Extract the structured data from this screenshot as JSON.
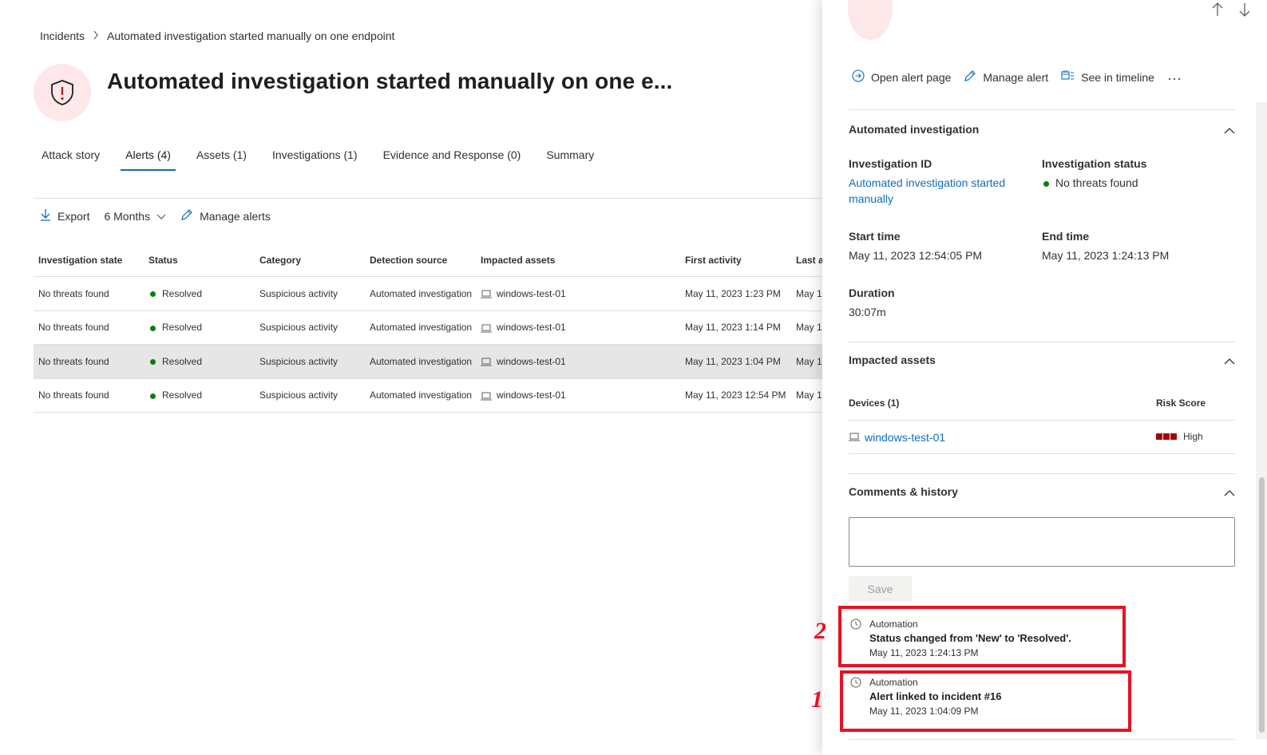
{
  "breadcrumb": {
    "root": "Incidents",
    "current": "Automated investigation started manually on one endpoint"
  },
  "page": {
    "title": "Automated investigation started manually on one e..."
  },
  "tabs": [
    {
      "label": "Attack story",
      "active": false
    },
    {
      "label": "Alerts (4)",
      "active": true
    },
    {
      "label": "Assets (1)",
      "active": false
    },
    {
      "label": "Investigations (1)",
      "active": false
    },
    {
      "label": "Evidence and Response (0)",
      "active": false
    },
    {
      "label": "Summary",
      "active": false
    }
  ],
  "toolbar": {
    "export": "Export",
    "range": "6 Months",
    "manage": "Manage alerts"
  },
  "table": {
    "headers": [
      "Investigation state",
      "Status",
      "Category",
      "Detection source",
      "Impacted assets",
      "First activity",
      "Last a"
    ],
    "rows": [
      {
        "state": "No threats found",
        "status": "Resolved",
        "category": "Suspicious activity",
        "source": "Automated investigation",
        "asset": "windows-test-01",
        "first": "May 11, 2023 1:23 PM",
        "last": "May 1",
        "selected": false
      },
      {
        "state": "No threats found",
        "status": "Resolved",
        "category": "Suspicious activity",
        "source": "Automated investigation",
        "asset": "windows-test-01",
        "first": "May 11, 2023 1:14 PM",
        "last": "May 1",
        "selected": false
      },
      {
        "state": "No threats found",
        "status": "Resolved",
        "category": "Suspicious activity",
        "source": "Automated investigation",
        "asset": "windows-test-01",
        "first": "May 11, 2023 1:04 PM",
        "last": "May 1",
        "selected": true
      },
      {
        "state": "No threats found",
        "status": "Resolved",
        "category": "Suspicious activity",
        "source": "Automated investigation",
        "asset": "windows-test-01",
        "first": "May 11, 2023 12:54 PM",
        "last": "May 1",
        "selected": false
      }
    ]
  },
  "panel": {
    "actions": {
      "open": "Open alert page",
      "manage": "Manage alert",
      "timeline": "See in timeline"
    },
    "auto": {
      "title": "Automated investigation",
      "id_label": "Investigation ID",
      "id_value": "Automated investigation started manually",
      "status_label": "Investigation status",
      "status_value": "No threats found",
      "start_label": "Start time",
      "start_value": "May 11, 2023 12:54:05 PM",
      "end_label": "End time",
      "end_value": "May 11, 2023 1:24:13 PM",
      "duration_label": "Duration",
      "duration_value": "30:07m"
    },
    "assets": {
      "title": "Impacted assets",
      "devices_label": "Devices (1)",
      "risk_label": "Risk Score",
      "device": "windows-test-01",
      "risk_value": "High"
    },
    "comments": {
      "title": "Comments & history",
      "save": "Save",
      "history": [
        {
          "who": "Automation",
          "what": "Status changed from 'New' to 'Resolved'.",
          "when": "May 11, 2023 1:24:13 PM",
          "marker": "2"
        },
        {
          "who": "Automation",
          "what": "Alert linked to incident #16",
          "when": "May 11, 2023 1:04:09 PM",
          "marker": "1"
        }
      ]
    }
  },
  "colors": {
    "accent": "#0f6cbd",
    "highlight": "#e81123",
    "resolved": "#107c10",
    "risk_high": "#a80000"
  }
}
